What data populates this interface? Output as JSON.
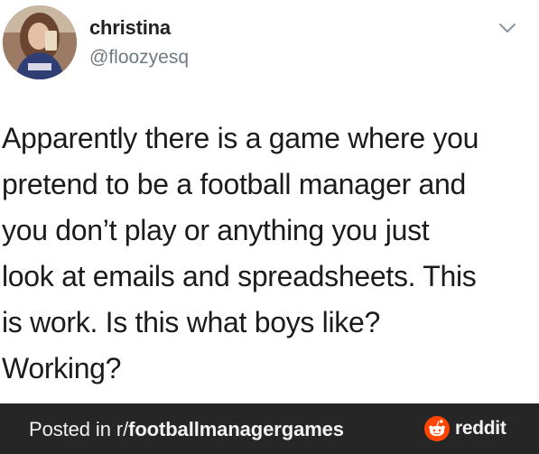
{
  "tweet": {
    "display_name": "christina",
    "handle": "@floozyesq",
    "avatar_icon": "profile-photo",
    "menu_icon": "chevron-down-icon",
    "text_lines": [
      "Apparently there is a game where you",
      "pretend to be a football manager and",
      "you don’t play or anything you just",
      "look at emails and spreadsheets. This",
      "is work. Is this what boys like?",
      "Working?"
    ]
  },
  "footer": {
    "posted_prefix": "Posted in r/",
    "subreddit": "footballmanagergames",
    "brand": "reddit",
    "brand_icon": "reddit-logo-icon",
    "brand_color": "#ff4500",
    "background": "#262626"
  }
}
